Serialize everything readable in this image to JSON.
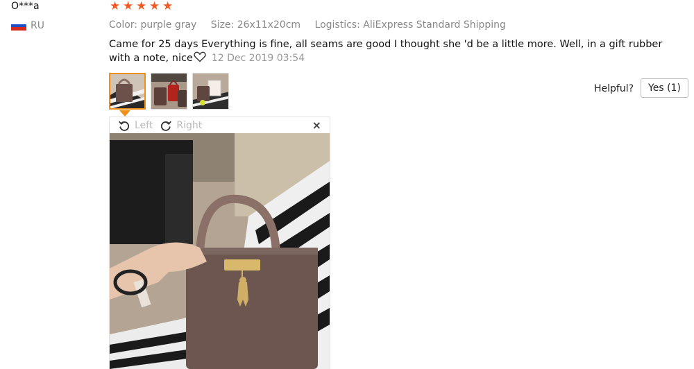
{
  "reviewer": {
    "name": "O***a",
    "country_code": "RU"
  },
  "rating": {
    "stars": 5,
    "max": 5,
    "star_color": "#f15a24"
  },
  "meta": {
    "color": "Color: purple gray",
    "size": "Size: 26x11x20cm",
    "logistics": "Logistics: AliExpress Standard Shipping"
  },
  "review": {
    "text": "Came for 25 days Everything is fine, all seams are good I thought she 'd be a little more. Well, in a gift rubber with a note, nice",
    "date": "12 Dec 2019 03:54"
  },
  "thumbnails": [
    {
      "name": "photo-1",
      "selected": true
    },
    {
      "name": "photo-2",
      "selected": false
    },
    {
      "name": "photo-3",
      "selected": false
    }
  ],
  "helpful": {
    "label": "Helpful?",
    "yes_label": "Yes (1)"
  },
  "viewer": {
    "rotate_left_label": "Left",
    "rotate_right_label": "Right",
    "close_symbol": "×"
  },
  "colors": {
    "accent_orange": "#f0901a",
    "muted_text": "#888888"
  }
}
